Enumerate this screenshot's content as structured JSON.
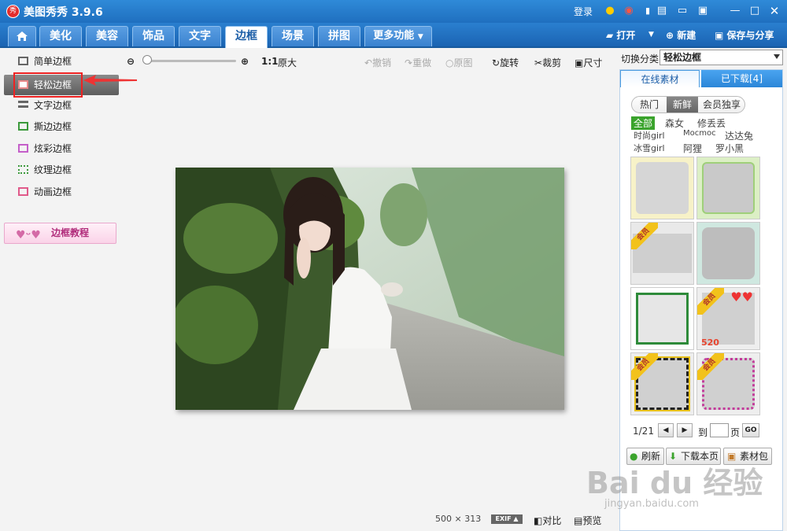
{
  "app": {
    "title": "美图秀秀 3.9.6",
    "logo_text": "秀"
  },
  "titlebar": {
    "login": "登录"
  },
  "tabs": [
    {
      "label": "美化"
    },
    {
      "label": "美容"
    },
    {
      "label": "饰品"
    },
    {
      "label": "文字"
    },
    {
      "label": "边框",
      "active": true
    },
    {
      "label": "场景"
    },
    {
      "label": "拼图"
    },
    {
      "label": "更多功能"
    }
  ],
  "tab_tools": {
    "open": "打开",
    "new": "新建",
    "save_share": "保存与分享"
  },
  "border_types": [
    {
      "label": "简单边框"
    },
    {
      "label": "轻松边框",
      "active": true
    },
    {
      "label": "文字边框"
    },
    {
      "label": "撕边边框"
    },
    {
      "label": "炫彩边框"
    },
    {
      "label": "纹理边框"
    },
    {
      "label": "动画边框"
    }
  ],
  "tutorial": {
    "label": "边框教程"
  },
  "toolbar": {
    "ratio": "1:1",
    "original_size": "原大",
    "undo": "撤销",
    "redo": "重做",
    "original": "原图",
    "rotate": "旋转",
    "crop": "裁剪",
    "size": "尺寸"
  },
  "status": {
    "width": "500",
    "times": "×",
    "height": "313",
    "exif": "EXIF",
    "compare": "对比",
    "preview": "预览"
  },
  "right": {
    "category_label": "切换分类",
    "category_value": "轻松边框",
    "tabs": {
      "online": "在线素材",
      "downloaded": "已下载[4]"
    },
    "subtabs": [
      "热门",
      "新鲜",
      "会员独享"
    ],
    "active_subtab": "新鲜",
    "filters": [
      "全部",
      "森女",
      "修丢丢",
      "时尚girl",
      "Mocmoc",
      "达达兔",
      "冰雪girl",
      "阿狸",
      "罗小黑"
    ],
    "member_badge": "会员",
    "thumb_text_520": "520",
    "pager": {
      "current": "1/21",
      "goto_label": "到",
      "page_label": "页",
      "go": "GO"
    },
    "actions": {
      "refresh": "刷新",
      "download_page": "下载本页",
      "package": "素材包"
    }
  },
  "watermark": {
    "main": "Bai du 经验",
    "sub": "jingyan.baidu.com"
  },
  "colors": {
    "titlebar": "#1f6fbf",
    "accent_blue": "#2a8ddb",
    "highlight_red": "#e22222",
    "filter_green": "#3aa32c"
  }
}
